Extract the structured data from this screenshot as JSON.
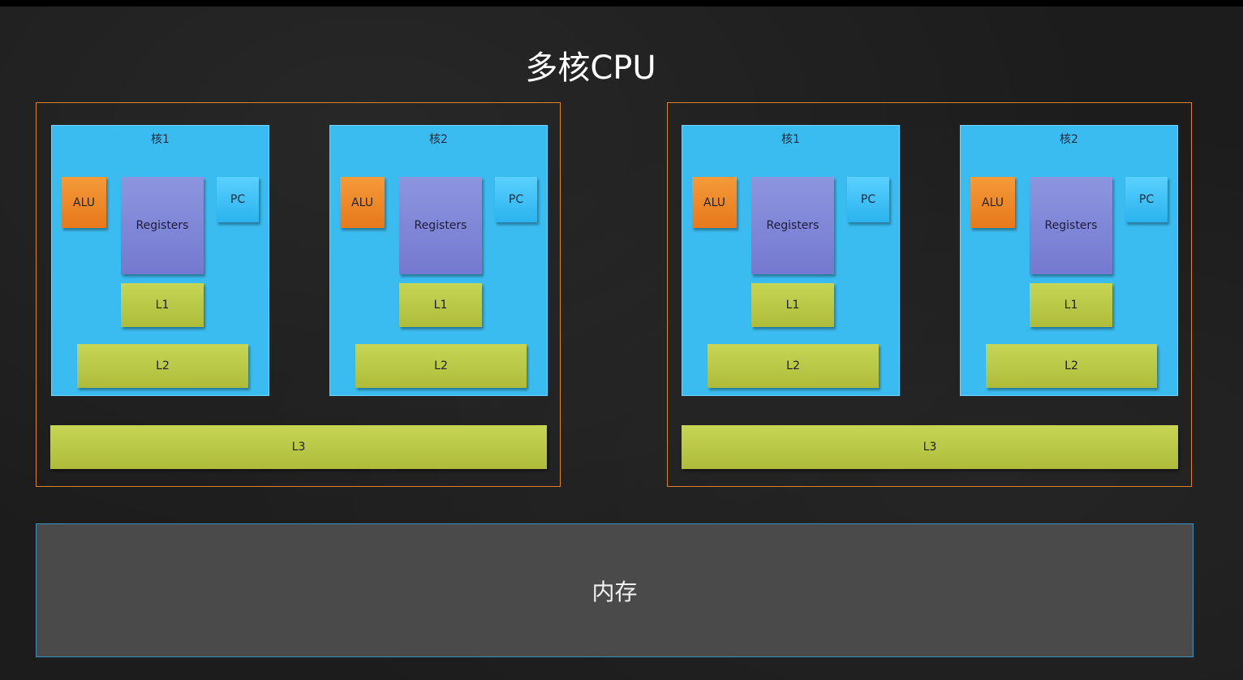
{
  "title": "多核CPU",
  "cpus": [
    {
      "cores": [
        {
          "name": "核1",
          "alu": "ALU",
          "registers": "Registers",
          "pc": "PC",
          "l1": "L1",
          "l2": "L2"
        },
        {
          "name": "核2",
          "alu": "ALU",
          "registers": "Registers",
          "pc": "PC",
          "l1": "L1",
          "l2": "L2"
        }
      ],
      "l3": "L3"
    },
    {
      "cores": [
        {
          "name": "核1",
          "alu": "ALU",
          "registers": "Registers",
          "pc": "PC",
          "l1": "L1",
          "l2": "L2"
        },
        {
          "name": "核2",
          "alu": "ALU",
          "registers": "Registers",
          "pc": "PC",
          "l1": "L1",
          "l2": "L2"
        }
      ],
      "l3": "L3"
    }
  ],
  "memory": "内存",
  "colors": {
    "background": "#1c1c1c",
    "cpu_border": "#d9822b",
    "core": "#3bbcf0",
    "alu": "#e6791b",
    "registers": "#7479cf",
    "pc": "#2bb3ee",
    "cache": "#aebc3a",
    "memory": "#4a4a4a"
  }
}
